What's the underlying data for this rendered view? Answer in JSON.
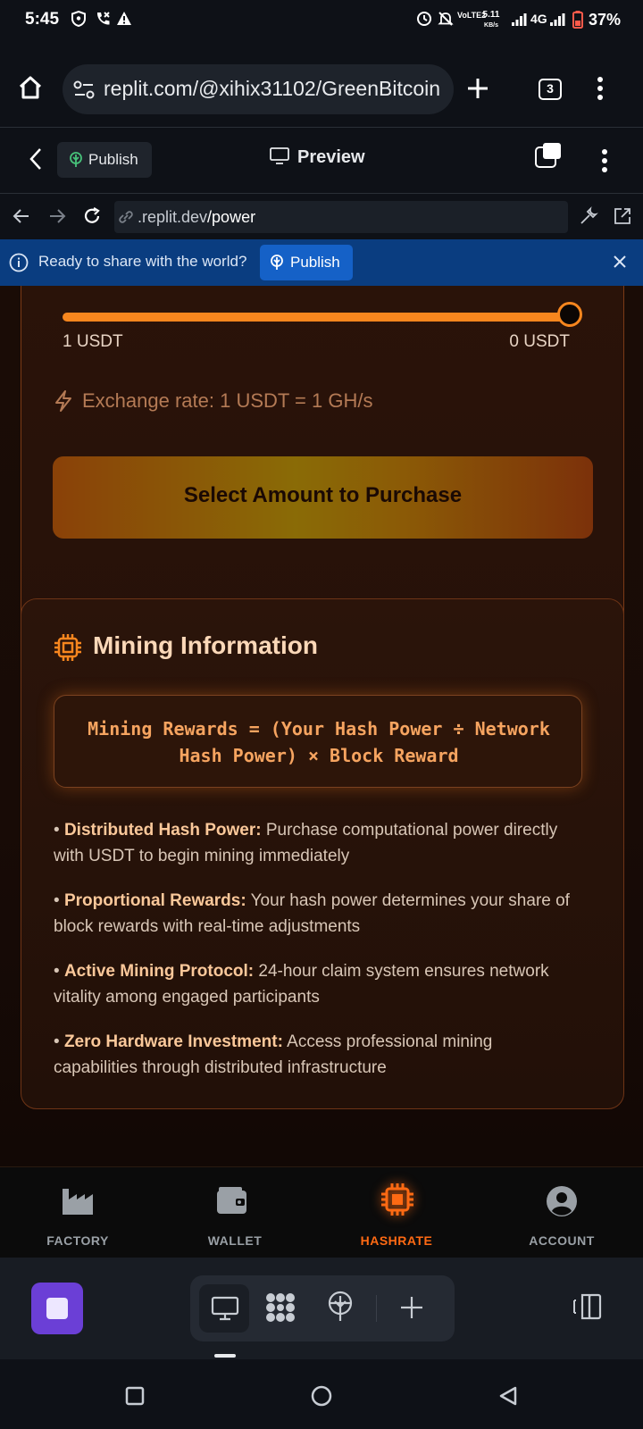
{
  "status_bar": {
    "time": "5:45",
    "network_speed": "5.11",
    "network_unit": "KB/s",
    "volte_label": "VoLTE2",
    "network_type": "4G",
    "battery": "37%"
  },
  "browser": {
    "url": "replit.com/@xihix31102/GreenBitcoin",
    "tab_count": "3"
  },
  "replit_header": {
    "publish_label": "Publish",
    "title": "Preview"
  },
  "address": {
    "domain": ".replit.dev",
    "path": "/power"
  },
  "banner": {
    "text": "Ready to share with the world?",
    "publish_label": "Publish"
  },
  "purchase": {
    "slider_fraction": 1.0,
    "min_label": "1 USDT",
    "max_label": "0 USDT",
    "exchange_rate": "Exchange rate: 1 USDT = 1 GH/s",
    "button_label": "Select Amount to Purchase"
  },
  "mining_info": {
    "title": "Mining Information",
    "formula": "Mining Rewards = (Your Hash Power ÷ Network Hash Power) × Block Reward",
    "bullets": [
      {
        "title": "Distributed Hash Power:",
        "text": "Purchase computational power directly with USDT to begin mining immediately"
      },
      {
        "title": "Proportional Rewards:",
        "text": "Your hash power determines your share of block rewards with real-time adjustments"
      },
      {
        "title": "Active Mining Protocol:",
        "text": "24-hour claim system ensures network vitality among engaged participants"
      },
      {
        "title": "Zero Hardware Investment:",
        "text": "Access professional mining capabilities through distributed infrastructure"
      }
    ]
  },
  "app_nav": {
    "items": [
      {
        "label": "FACTORY",
        "icon": "factory-icon",
        "active": false
      },
      {
        "label": "WALLET",
        "icon": "wallet-icon",
        "active": false
      },
      {
        "label": "HASHRATE",
        "icon": "chip-icon",
        "active": true
      },
      {
        "label": "ACCOUNT",
        "icon": "account-icon",
        "active": false
      }
    ]
  },
  "colors": {
    "accent_orange": "#f7861e",
    "nav_active": "#ff6a13",
    "banner_blue": "#0a3d80",
    "stop_purple": "#6b3fd6"
  }
}
